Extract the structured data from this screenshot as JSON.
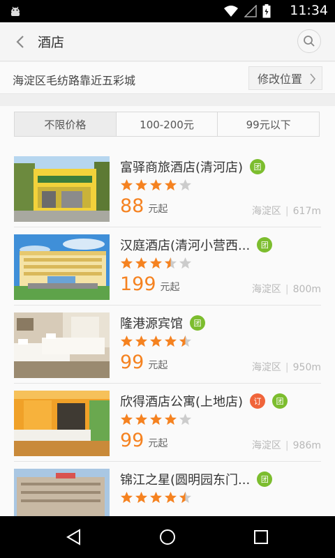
{
  "status_bar": {
    "time": "11:34"
  },
  "toolbar": {
    "title": "酒店"
  },
  "location": {
    "address": "海淀区毛纺路靠近五彩城",
    "change_label": "修改位置"
  },
  "price_filter": {
    "options": [
      "不限价格",
      "100-200元",
      "99元以下"
    ],
    "selected": "不限价格"
  },
  "hotels": [
    {
      "name": "富驿商旅酒店(清河店)",
      "badges": [
        "团"
      ],
      "rating": 4,
      "price": "88",
      "price_suffix": "元起",
      "district": "海淀区",
      "distance": "617m"
    },
    {
      "name": "汉庭酒店(清河小营西...",
      "badges": [
        "团"
      ],
      "rating": 3.5,
      "price": "199",
      "price_suffix": "元起",
      "district": "海淀区",
      "distance": "800m"
    },
    {
      "name": "隆港源宾馆",
      "badges": [
        "团"
      ],
      "rating": 4.5,
      "price": "99",
      "price_suffix": "元起",
      "district": "海淀区",
      "distance": "950m"
    },
    {
      "name": "欣得酒店公寓(上地店)",
      "badges": [
        "订",
        "团"
      ],
      "rating": 4,
      "price": "99",
      "price_suffix": "元起",
      "district": "海淀区",
      "distance": "986m"
    },
    {
      "name": "锦江之星(圆明园东门...",
      "badges": [
        "团"
      ],
      "rating": 4.5,
      "price": "",
      "price_suffix": "",
      "district": "",
      "distance": ""
    }
  ],
  "colors": {
    "accent_orange": "#f58220",
    "tuan_green": "#7cbd2e",
    "ding_red": "#f0643a",
    "star_orange": "#f58220",
    "star_gray": "#cccccc"
  },
  "icons": {
    "back": "chevron-left-icon",
    "search": "search-icon",
    "change_location": "chevron-right-icon"
  }
}
